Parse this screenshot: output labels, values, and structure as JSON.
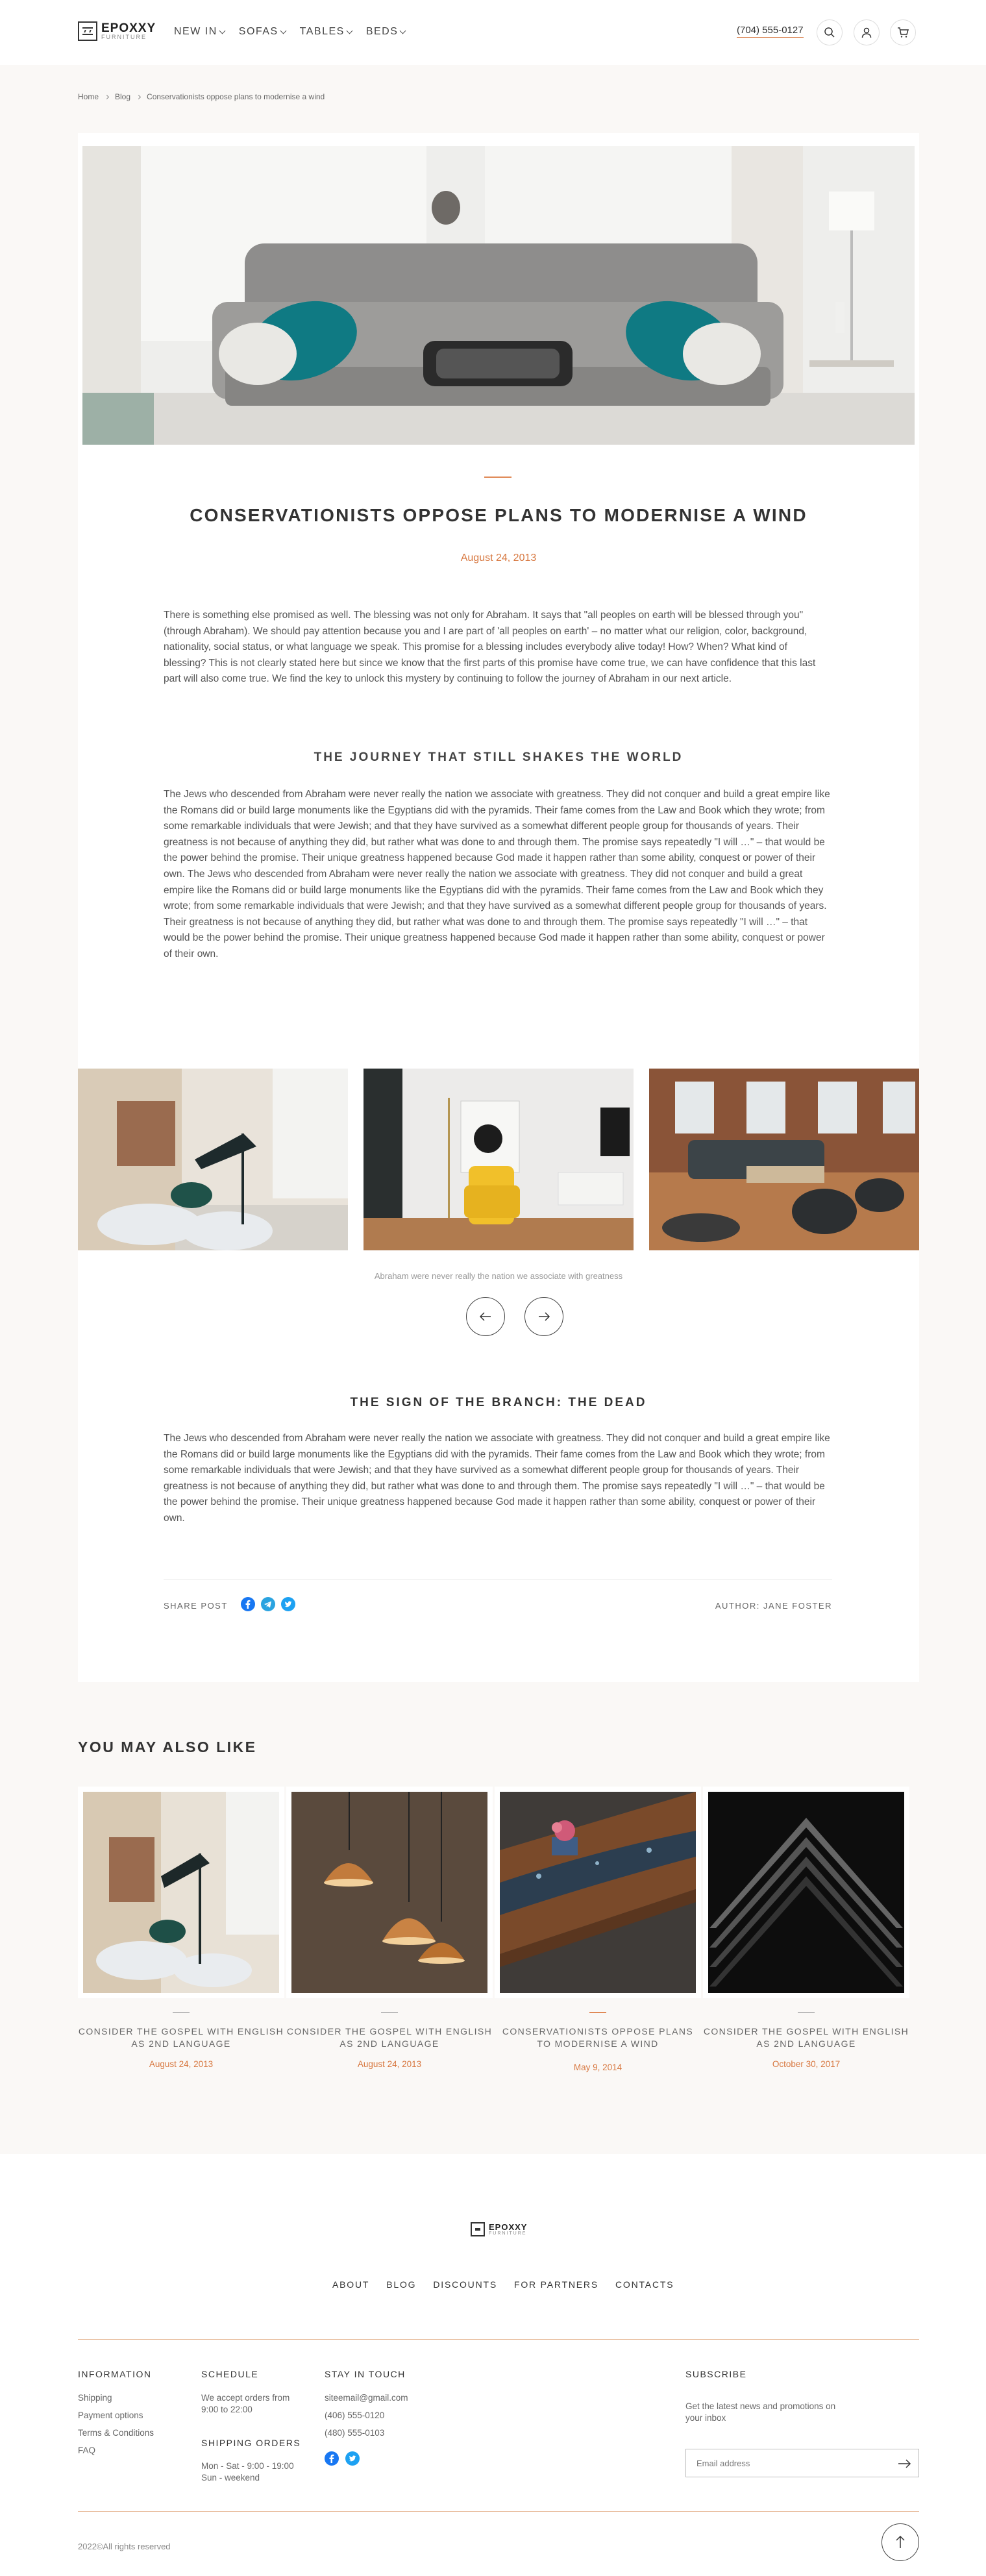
{
  "header": {
    "logo_name": "EPOXXY",
    "logo_sub": "FURNITURE",
    "nav": [
      {
        "label": "NEW IN"
      },
      {
        "label": "SOFAS"
      },
      {
        "label": "TABLES"
      },
      {
        "label": "BEDS"
      }
    ],
    "phone": "(704) 555-0127"
  },
  "breadcrumb": [
    "Home",
    "Blog",
    "Conservationists oppose plans to modernise a wind"
  ],
  "article": {
    "title": "CONSERVATIONISTS OPPOSE PLANS TO MODERNISE A WIND",
    "date": "August 24, 2013",
    "intro": "There is something else promised as well. The blessing was not only for Abraham. It says that \"all peoples on earth will be blessed through you\" (through Abraham). We should pay attention because you and I are part of 'all peoples on earth' – no matter what our religion, color, background, nationality, social status, or what language we speak. This promise for a blessing includes everybody alive today! How? When? What kind of blessing? This is not clearly stated here but since we know that the first parts of this promise have come true, we can have confidence that this last part will also come true. We find the key to unlock this mystery by continuing to follow the journey of Abraham in our next article.",
    "heading1": "THE JOURNEY THAT STILL SHAKES THE WORLD",
    "body1": "The Jews who descended from Abraham were never really the nation we associate with greatness. They did not conquer and build a great empire like the Romans did or build large monuments like the Egyptians did with the pyramids. Their fame comes from the Law and Book which they wrote; from some remarkable individuals that were Jewish; and that they have survived as a somewhat different people group for thousands of years. Their greatness is not because of anything they did, but rather what was done to and through them. The promise says repeatedly \"I will …\" – that would be the power behind the promise. Their unique greatness happened because God made it happen rather than some ability, conquest or power of their own. The Jews who descended from Abraham were never really the nation we associate with greatness. They did not conquer and build a great empire like the Romans did or build large monuments like the Egyptians did with the pyramids. Their fame comes from the Law and Book which they wrote; from some remarkable individuals that were Jewish; and that they have survived as a somewhat different people group for thousands of years. Their greatness is not because of anything they did, but rather what was done to and through them. The promise says repeatedly \"I will …\" – that would be the power behind the promise. Their unique greatness happened because God made it happen rather than some ability, conquest or power of their own.",
    "gallery_caption": "Abraham were never really the nation we associate with greatness",
    "heading2": "THE SIGN OF THE BRANCH: THE DEAD",
    "body2": "The Jews who descended from Abraham were never really the nation we associate with greatness. They did not conquer and build a great empire like the Romans did or build large monuments like the Egyptians did with the pyramids. Their fame comes from the Law and Book which they wrote; from some remarkable individuals that were Jewish; and that they have survived as a somewhat different people group for thousands of years. Their greatness is not because of anything they did, but rather what was done to and through them. The promise says repeatedly \"I will …\" – that would be the power behind the promise. Their unique greatness happened because God made it happen rather than some ability, conquest or power of their own.",
    "share_label": "SHARE POST",
    "author": "AUTHOR: JANE FOSTER"
  },
  "related": {
    "heading": "YOU MAY ALSO LIKE",
    "items": [
      {
        "title": "CONSIDER THE GOSPEL WITH ENGLISH AS 2ND LANGUAGE",
        "date": "August 24, 2013"
      },
      {
        "title": "CONSIDER THE GOSPEL WITH ENGLISH AS 2ND LANGUAGE",
        "date": "August 24, 2013"
      },
      {
        "title": "CONSERVATIONISTS OPPOSE PLANS TO MODERNISE A WIND",
        "date": "May 9, 2014"
      },
      {
        "title": "CONSIDER THE GOSPEL WITH ENGLISH AS 2ND LANGUAGE",
        "date": "October 30, 2017"
      }
    ]
  },
  "footer": {
    "nav": [
      "ABOUT",
      "BLOG",
      "DISCOUNTS",
      "FOR PARTNERS",
      "CONTACTS"
    ],
    "information": {
      "heading": "INFORMATION",
      "links": [
        "Shipping",
        "Payment options",
        "Terms & Conditions",
        "FAQ"
      ]
    },
    "schedule": {
      "heading": "SCHEDULE",
      "text": "We accept orders from 9:00 to 22:00",
      "shipping_heading": "SHIPPING ORDERS",
      "shipping_text": "Mon - Sat - 9:00 - 19:00 Sun - weekend"
    },
    "contact": {
      "heading": "STAY IN TOUCH",
      "email": "siteemail@gmail.com",
      "phone1": "(406) 555-0120",
      "phone2": "(480) 555-0103"
    },
    "subscribe": {
      "heading": "SUBSCRIBE",
      "text": "Get the latest news and promotions on your inbox",
      "placeholder": "Email address"
    },
    "copyright": "2022©All rights reserved"
  },
  "colors": {
    "accent": "#d7773f",
    "facebook": "#1877f2",
    "telegram": "#2aa3e0",
    "twitter": "#1da1f2"
  }
}
